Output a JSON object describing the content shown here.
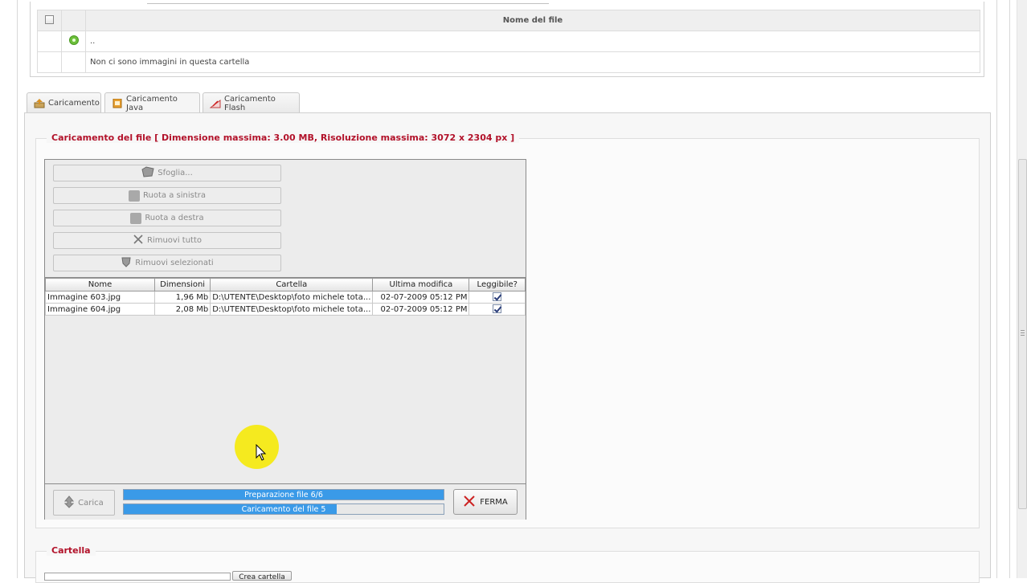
{
  "file_table": {
    "header": "Nome del file",
    "rows": [
      {
        "name": ".."
      },
      {
        "name": "Non ci sono immagini in questa cartella"
      }
    ]
  },
  "tabs": [
    {
      "label": "Caricamento"
    },
    {
      "label": "Caricamento Java"
    },
    {
      "label": "Caricamento Flash"
    }
  ],
  "upload": {
    "legend": "Caricamento del file [ Dimensione massima: 3.00 MB, Risoluzione massima: 3072 x 2304 px ]",
    "buttons": {
      "browse": "Sfoglia...",
      "rotate_left": "Ruota a sinistra",
      "rotate_right": "Ruota a destra",
      "remove_all": "Rimuovi tutto",
      "remove_selected": "Rimuovi selezionati"
    },
    "columns": [
      "Nome",
      "Dimensioni",
      "Cartella",
      "Ultima modifica",
      "Leggibile?"
    ],
    "files": [
      {
        "name": "Immagine 603.jpg",
        "size": "1,96 Mb",
        "folder": "D:\\UTENTE\\Desktop\\foto michele tota...",
        "modified": "02-07-2009 05:12 PM",
        "readable": true
      },
      {
        "name": "Immagine 604.jpg",
        "size": "2,08 Mb",
        "folder": "D:\\UTENTE\\Desktop\\foto michele tota...",
        "modified": "02-07-2009 05:12 PM",
        "readable": true
      }
    ],
    "carica_label": "Carica",
    "progress_prep": {
      "label": "Preparazione file 6/6",
      "fraction": 1.0
    },
    "progress_upload": {
      "label": "Caricamento del file 5",
      "fraction": 0.665
    },
    "stop_label": "FERMA"
  },
  "cartella": {
    "legend": "Cartella",
    "button_label": "Crea cartella"
  },
  "colors": {
    "legend_red": "#b2122a",
    "progress_blue": "#3a9ae8",
    "cursor_highlight": "#f5ea1f"
  }
}
